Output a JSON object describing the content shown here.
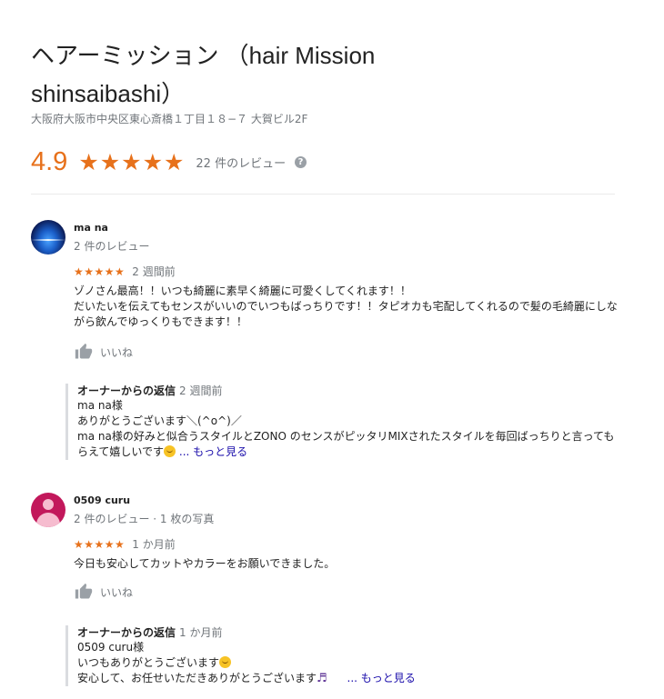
{
  "business": {
    "name": "ヘアーミッション （hair Mission shinsaibashi）",
    "address": "大阪府大阪市中央区東心斎橋１丁目１８−７ 大賀ビル2F",
    "rating": "4.9",
    "rating_stars": "★★★★★",
    "review_count": "22 件のレビュー",
    "help_glyph": "?"
  },
  "reviews": [
    {
      "name": "ma na",
      "meta": "2 件のレビュー",
      "stars": "★★★★★",
      "date": "2 週間前",
      "text": "ゾノさん最高！！いつも綺麗に素早く綺麗に可愛くしてくれます！！\nだいたいを伝えてもセンスがいいのでいつもばっちりです！！タピオカも宅配してくれるので髪の毛綺麗にしながら飲んでゆっくりもできます！！",
      "like_label": "いいね",
      "reply": {
        "owner_label": "オーナーからの返信",
        "date": "2 週間前",
        "line1": "ma na様",
        "line2": "ありがとうございます＼(^o^)／",
        "line3": "ma na様の好みと似合うスタイルとZONO のセンスがピッタリMIXされたスタイルを毎回ばっちりと言ってもらえて嬉しいです",
        "more_label": "... もっと見る"
      }
    },
    {
      "name": "0509 curu",
      "meta": "2 件のレビュー · 1 枚の写真",
      "stars": "★★★★★",
      "date": "1 か月前",
      "text": "今日も安心してカットやカラーをお願いできました。",
      "like_label": "いいね",
      "reply": {
        "owner_label": "オーナーからの返信",
        "date": "1 か月前",
        "line1": "0509 curu様",
        "line2": "いつもありがとうございます",
        "line3": "安心して、お任せいただきありがとうございます",
        "more_label": "... もっと見る"
      }
    }
  ],
  "colors": {
    "accent": "#e7711b",
    "link": "#1a0dab",
    "secondary_text": "#70757a"
  }
}
